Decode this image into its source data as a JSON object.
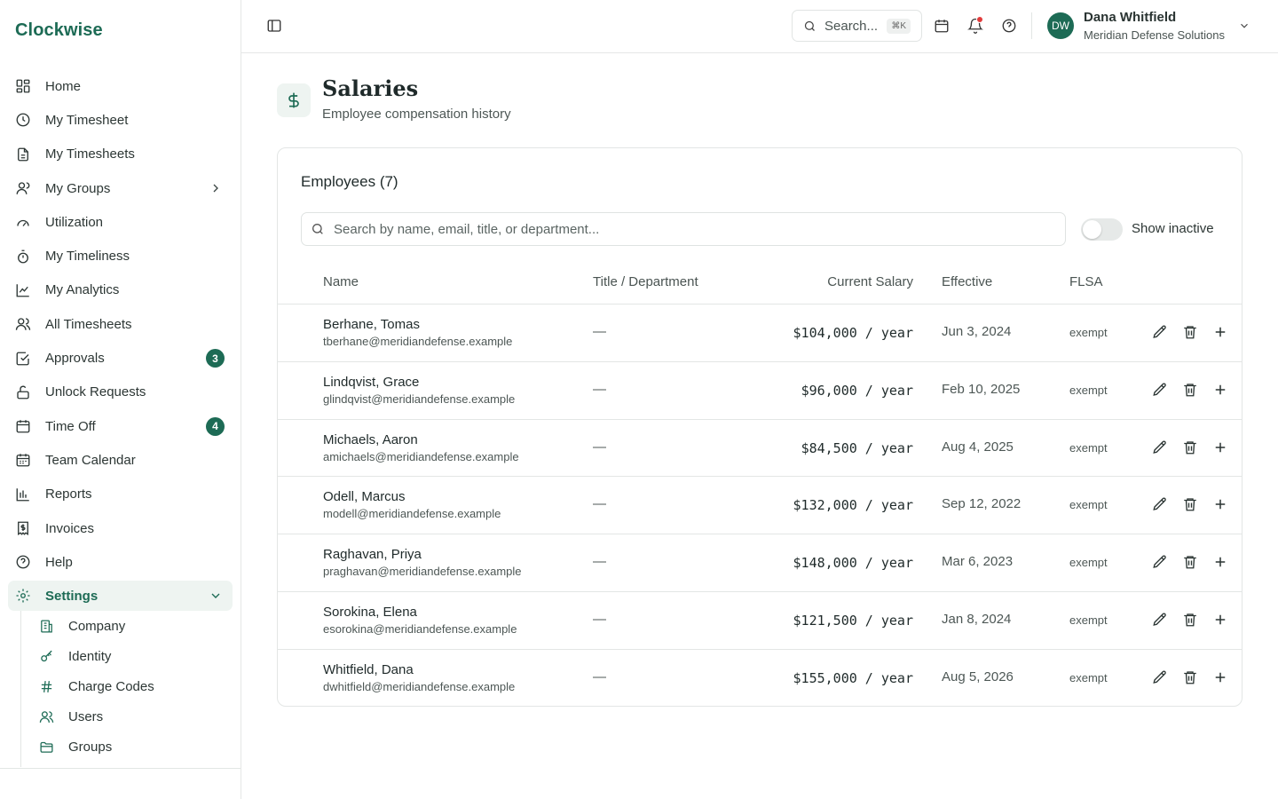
{
  "app": {
    "name": "Clockwise"
  },
  "sidebar": {
    "items": [
      {
        "label": "Home",
        "icon": "dashboard-icon"
      },
      {
        "label": "My Timesheet",
        "icon": "clock-icon"
      },
      {
        "label": "My Timesheets",
        "icon": "document-icon"
      },
      {
        "label": "My Groups",
        "icon": "user-icon"
      },
      {
        "label": "Utilization",
        "icon": "gauge-icon"
      },
      {
        "label": "My Timeliness",
        "icon": "stopwatch-icon"
      },
      {
        "label": "My Analytics",
        "icon": "line-chart-icon"
      },
      {
        "label": "All Timesheets",
        "icon": "users-icon"
      },
      {
        "label": "Approvals",
        "icon": "check-square-icon",
        "badge": "3"
      },
      {
        "label": "Unlock Requests",
        "icon": "unlock-icon"
      },
      {
        "label": "Time Off",
        "icon": "calendar-icon",
        "badge": "4"
      },
      {
        "label": "Team Calendar",
        "icon": "calendar-grid-icon"
      },
      {
        "label": "Reports",
        "icon": "bar-chart-icon"
      },
      {
        "label": "Invoices",
        "icon": "receipt-icon"
      },
      {
        "label": "Help",
        "icon": "help-icon"
      },
      {
        "label": "Settings",
        "icon": "gear-icon"
      }
    ],
    "settings_sub": [
      {
        "label": "Company",
        "icon": "building-icon"
      },
      {
        "label": "Identity",
        "icon": "key-icon"
      },
      {
        "label": "Charge Codes",
        "icon": "hash-icon"
      },
      {
        "label": "Users",
        "icon": "users-icon"
      },
      {
        "label": "Groups",
        "icon": "folder-icon"
      }
    ]
  },
  "topbar": {
    "search_placeholder": "Search...",
    "search_shortcut": "⌘K",
    "user": {
      "initials": "DW",
      "name": "Dana Whitfield",
      "org": "Meridian Defense Solutions"
    }
  },
  "page": {
    "title": "Salaries",
    "subtitle": "Employee compensation history"
  },
  "employees": {
    "title": "Employees (7)",
    "search_placeholder": "Search by name, email, title, or department...",
    "show_inactive_label": "Show inactive",
    "columns": {
      "name": "Name",
      "title": "Title / Department",
      "salary": "Current Salary",
      "effective": "Effective",
      "flsa": "FLSA"
    },
    "rows": [
      {
        "name": "Berhane, Tomas",
        "email": "tberhane@meridiandefense.example",
        "title": "—",
        "salary": "$104,000 / year",
        "effective": "Jun 3, 2024",
        "flsa": "exempt"
      },
      {
        "name": "Lindqvist, Grace",
        "email": "glindqvist@meridiandefense.example",
        "title": "—",
        "salary": "$96,000 / year",
        "effective": "Feb 10, 2025",
        "flsa": "exempt"
      },
      {
        "name": "Michaels, Aaron",
        "email": "amichaels@meridiandefense.example",
        "title": "—",
        "salary": "$84,500 / year",
        "effective": "Aug 4, 2025",
        "flsa": "exempt"
      },
      {
        "name": "Odell, Marcus",
        "email": "modell@meridiandefense.example",
        "title": "—",
        "salary": "$132,000 / year",
        "effective": "Sep 12, 2022",
        "flsa": "exempt"
      },
      {
        "name": "Raghavan, Priya",
        "email": "praghavan@meridiandefense.example",
        "title": "—",
        "salary": "$148,000 / year",
        "effective": "Mar 6, 2023",
        "flsa": "exempt"
      },
      {
        "name": "Sorokina, Elena",
        "email": "esorokina@meridiandefense.example",
        "title": "—",
        "salary": "$121,500 / year",
        "effective": "Jan 8, 2024",
        "flsa": "exempt"
      },
      {
        "name": "Whitfield, Dana",
        "email": "dwhitfield@meridiandefense.example",
        "title": "—",
        "salary": "$155,000 / year",
        "effective": "Aug 5, 2026",
        "flsa": "exempt"
      }
    ]
  },
  "colors": {
    "accent": "#1d6b55",
    "accent_soft": "#eef4f1",
    "notification": "#e23b3b"
  }
}
